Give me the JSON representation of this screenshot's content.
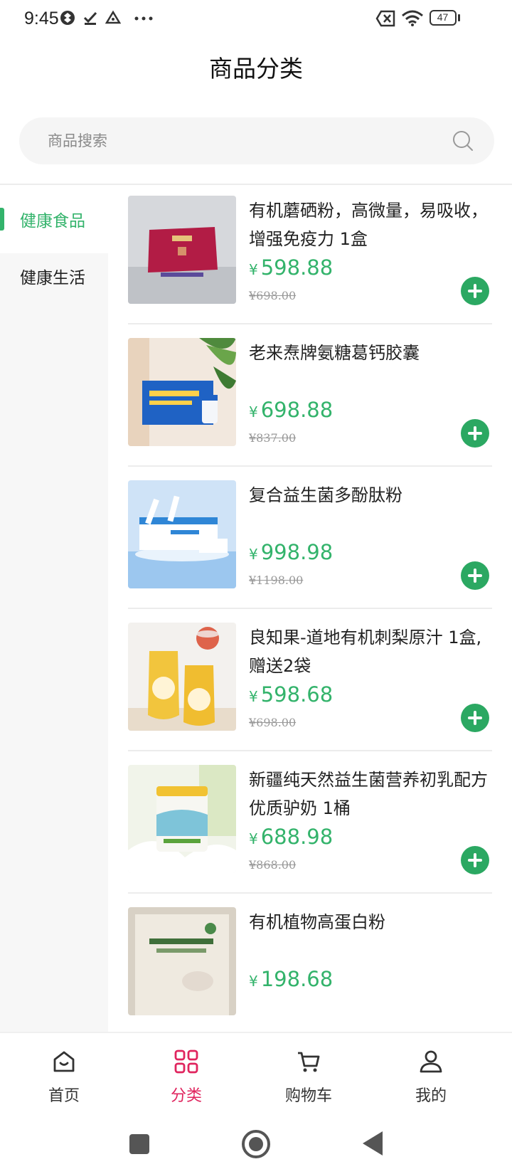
{
  "status_bar": {
    "time": "9:45",
    "battery": "47"
  },
  "header": {
    "title": "商品分类"
  },
  "search": {
    "placeholder": "商品搜索"
  },
  "categories": [
    {
      "label": "健康食品",
      "active": true
    },
    {
      "label": "健康生活",
      "active": false
    }
  ],
  "products": [
    {
      "name": "有机蘑硒粉，高微量，易吸收，增强免疫力 1盒",
      "currency": "¥",
      "price": "598.88",
      "original_price": "¥698.00",
      "image": "red-gift-box"
    },
    {
      "name": "老来焘牌氨糖葛钙胶囊",
      "currency": "¥",
      "price": "698.88",
      "original_price": "¥837.00",
      "image": "blue-capsule-box"
    },
    {
      "name": "复合益生菌多酚肽粉",
      "currency": "¥",
      "price": "998.98",
      "original_price": "¥1198.00",
      "image": "probiotic-packets"
    },
    {
      "name": "良知果-道地有机刺梨原汁 1盒,赠送2袋",
      "currency": "¥",
      "price": "598.68",
      "original_price": "¥698.00",
      "image": "yellow-juice-pouches"
    },
    {
      "name": "新疆纯天然益生菌营养初乳配方优质驴奶 1桶",
      "currency": "¥",
      "price": "688.98",
      "original_price": "¥868.00",
      "image": "milk-powder-can"
    },
    {
      "name": "有机植物高蛋白粉",
      "currency": "¥",
      "price": "198.68",
      "original_price": "",
      "image": "protein-powder-box"
    }
  ],
  "tab_bar": {
    "tabs": [
      {
        "label": "首页",
        "icon": "home-icon",
        "active": false
      },
      {
        "label": "分类",
        "icon": "grid-icon",
        "active": true
      },
      {
        "label": "购物车",
        "icon": "cart-icon",
        "active": false
      },
      {
        "label": "我的",
        "icon": "user-icon",
        "active": false
      }
    ]
  },
  "colors": {
    "accent_green": "#33b36b",
    "tab_active": "#e0245e"
  }
}
